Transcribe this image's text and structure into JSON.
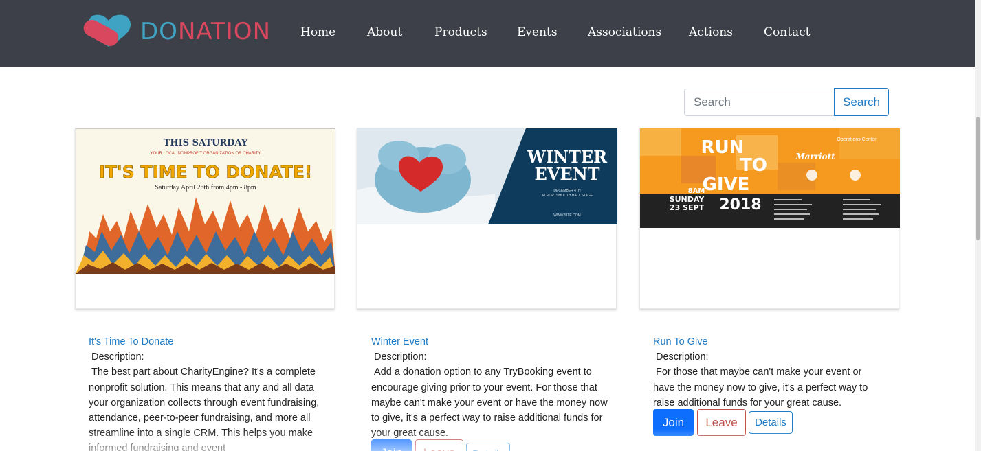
{
  "brand": {
    "logo_text_a": "DO",
    "logo_text_b": "NATION",
    "heart_color": "#3fa3c4",
    "accent_color": "#d9475f"
  },
  "nav": {
    "items": [
      {
        "label": "Home"
      },
      {
        "label": "About"
      },
      {
        "label": "Products"
      },
      {
        "label": "Events"
      },
      {
        "label": "Associations"
      },
      {
        "label": "Actions"
      },
      {
        "label": "Contact"
      }
    ]
  },
  "search": {
    "placeholder": "Search",
    "button_label": "Search"
  },
  "events": [
    {
      "title": "It's Time To Donate",
      "description_label": "Description:",
      "description": "The best part about CharityEngine? It's a complete nonprofit solution. This means that any and all data your organization collects through event fundraising, attendance, peer-to-peer fundraising, and more all streamline into a single CRM. This helps you make informed fundraising and event",
      "poster": {
        "heading": "THIS SATURDAY",
        "subheading": "YOUR LOCAL NONPROFIT ORGANIZATION OR CHARITY",
        "headline": "IT'S TIME TO DONATE!",
        "date_line": "Saturday April 26th from 4pm - 8pm"
      }
    },
    {
      "title": "Winter Event",
      "description_label": "Description:",
      "description": "Add a donation option to any TryBooking event to encourage giving prior to your event. For those that maybe can't make your event or have the money now to give, it's a perfect way to raise additional funds for your great cause.",
      "join_label": "Join",
      "leave_label": "Leave",
      "details_label": "Details",
      "poster": {
        "headline_1": "WINTER",
        "headline_2": "EVENT",
        "date_line": "DECEMBER 4TH",
        "venue_line": "AT PORTSMOUTH HALL STAGE",
        "url": "WWW.SITE.COM"
      }
    },
    {
      "title": "Run To Give",
      "description_label": "Description:",
      "description": "For those that maybe can't make your event or have the money now to give, it's a perfect way to raise additional funds for your great cause.",
      "join_label": "Join",
      "leave_label": "Leave",
      "details_label": "Details",
      "poster": {
        "word_1": "RUN",
        "word_2": "TO",
        "word_3": "GIVE",
        "time": "8AM",
        "day": "SUNDAY",
        "date": "23 SEPT",
        "year": "2018",
        "sponsor_1": "Marriott",
        "sponsor_2": "Operations Center"
      }
    }
  ]
}
